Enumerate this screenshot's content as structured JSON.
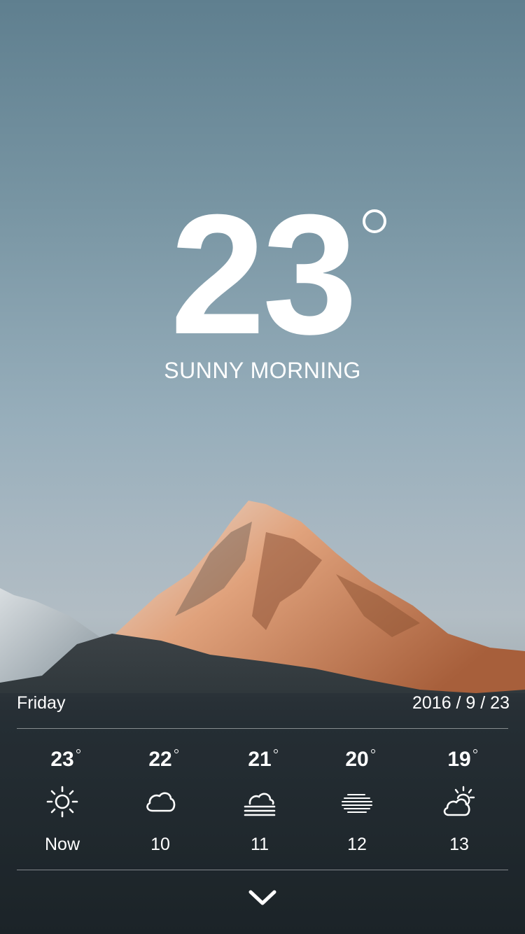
{
  "current": {
    "temperature": "23",
    "condition": "SUNNY MORNING"
  },
  "date_bar": {
    "day": "Friday",
    "date": "2016 / 9 / 23"
  },
  "forecast": [
    {
      "temp": "23",
      "icon": "sun-icon",
      "label": "Now"
    },
    {
      "temp": "22",
      "icon": "cloud-icon",
      "label": "10"
    },
    {
      "temp": "21",
      "icon": "cloud-fog-icon",
      "label": "11"
    },
    {
      "temp": "20",
      "icon": "fog-icon",
      "label": "12"
    },
    {
      "temp": "19",
      "icon": "partly-cloudy-icon",
      "label": "13"
    }
  ],
  "expand": {
    "icon": "chevron-down-icon"
  },
  "colors": {
    "text": "#ffffff",
    "sky_top": "#5f7f8f",
    "sky_bottom": "#b2bdc4"
  }
}
